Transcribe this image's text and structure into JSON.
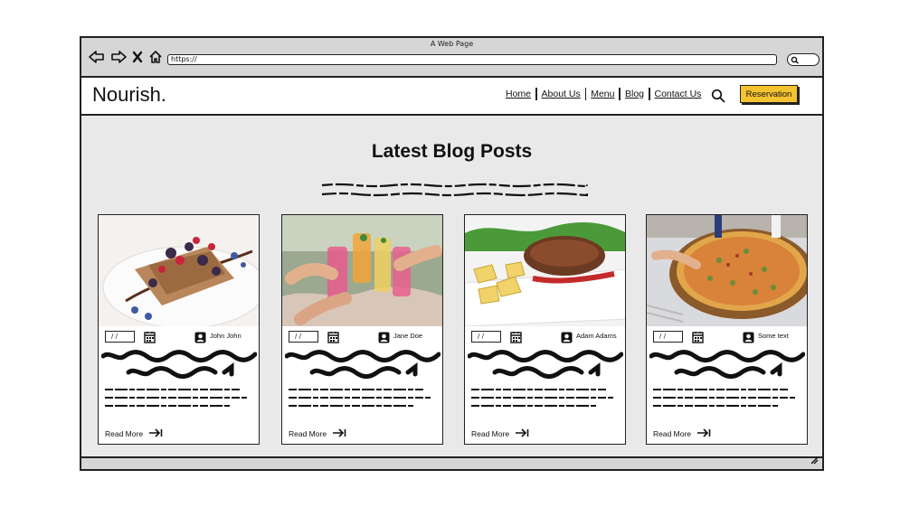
{
  "window": {
    "title": "A Web Page",
    "address": "https://"
  },
  "site": {
    "logo": "Nourish.",
    "nav": [
      {
        "label": "Home"
      },
      {
        "label": "About Us"
      },
      {
        "label": "Menu"
      },
      {
        "label": "Blog"
      },
      {
        "label": "Contact Us"
      }
    ],
    "cta": "Reservation"
  },
  "main": {
    "heading": "Latest Blog Posts",
    "cards": [
      {
        "date": "/ /",
        "author": "John John",
        "read_more": "Read More",
        "image": "waffle-dessert-photo"
      },
      {
        "date": "/ /",
        "author": "Jane Doe",
        "read_more": "Read More",
        "image": "cocktails-toast-photo"
      },
      {
        "date": "/ /",
        "author": "Adam Adams",
        "read_more": "Read More",
        "image": "steak-potatoes-photo"
      },
      {
        "date": "/ /",
        "author": "Some text",
        "read_more": "Read More",
        "image": "pizza-photo"
      }
    ]
  },
  "colors": {
    "accent": "#f5c230",
    "frame": "#222222",
    "chrome": "#d6d6d6",
    "background": "#e9e9e9"
  }
}
